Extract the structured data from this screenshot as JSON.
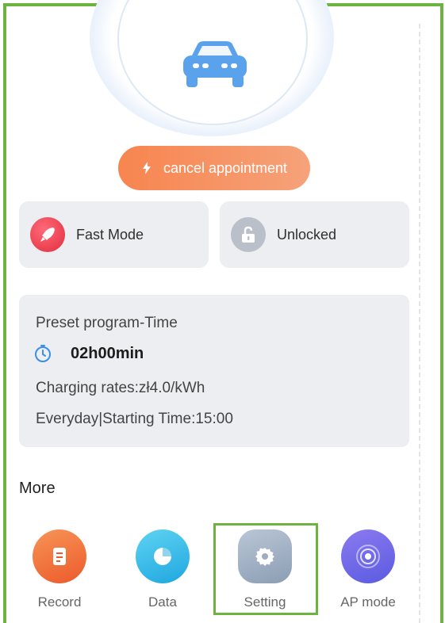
{
  "charging": {
    "cancel_label": "cancel appointment"
  },
  "modes": {
    "fast_label": "Fast Mode",
    "lock_label": "Unlocked"
  },
  "preset": {
    "title": "Preset program-Time",
    "duration": "02h00min",
    "rate": "Charging rates:zł4.0/kWh",
    "schedule": "Everyday|Starting Time:15:00"
  },
  "more": {
    "title": "More",
    "items": [
      {
        "label": "Record",
        "icon": "record-icon"
      },
      {
        "label": "Data",
        "icon": "pie-chart-icon"
      },
      {
        "label": "Setting",
        "icon": "gear-icon"
      },
      {
        "label": "AP mode",
        "icon": "wifi-signal-icon"
      }
    ]
  },
  "colors": {
    "accent_orange": "#f7854f",
    "highlight_green": "#6db33f",
    "card_bg": "#eceef1",
    "car_blue": "#5aa3ec"
  }
}
